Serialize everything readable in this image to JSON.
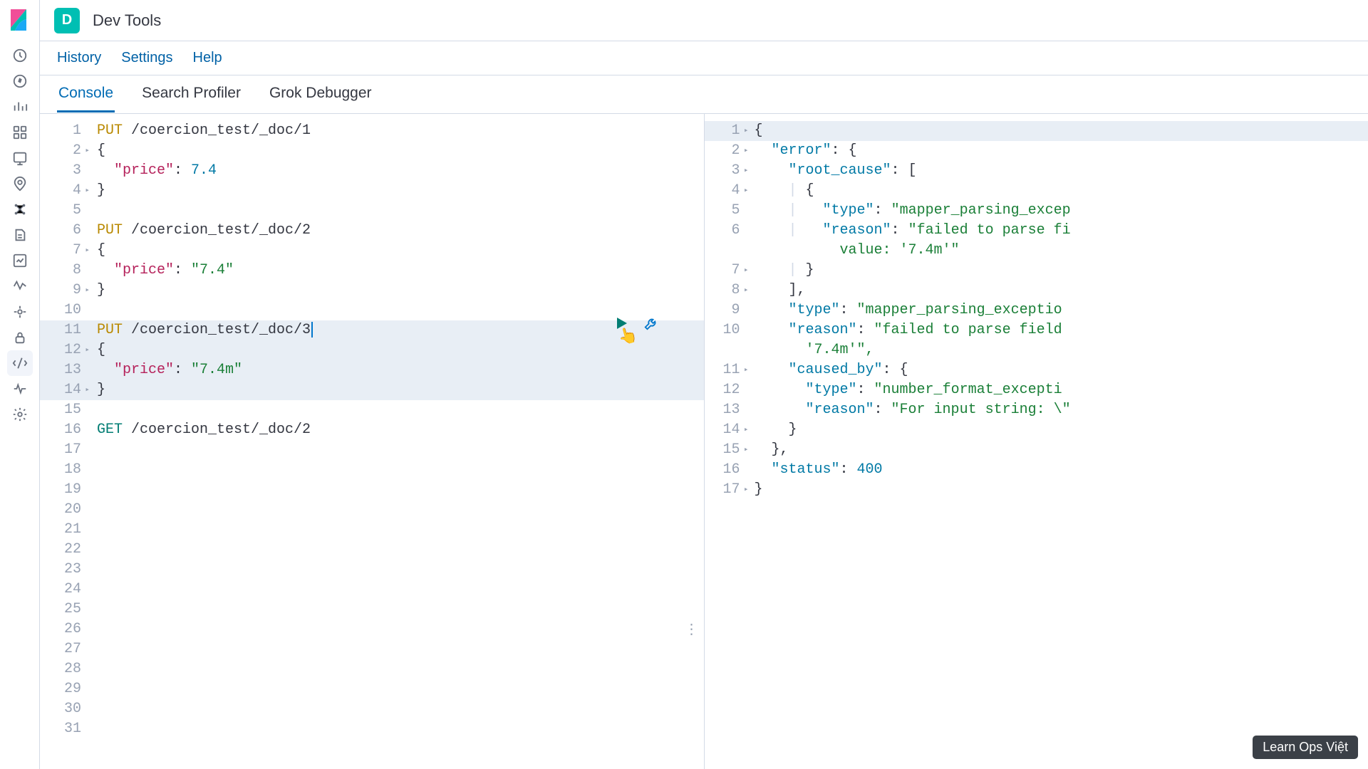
{
  "header": {
    "space_initial": "D",
    "title": "Dev Tools"
  },
  "subheader": {
    "history": "History",
    "settings": "Settings",
    "help": "Help"
  },
  "tabs": {
    "console": "Console",
    "search_profiler": "Search Profiler",
    "grok_debugger": "Grok Debugger"
  },
  "editor": {
    "total_lines": 31,
    "highlight_start": 11,
    "highlight_end": 14,
    "lines": [
      {
        "n": 1,
        "fold": false,
        "segs": [
          {
            "t": "PUT",
            "c": "method-put"
          },
          {
            "t": " /coercion_test/_doc/1",
            "c": ""
          }
        ]
      },
      {
        "n": 2,
        "fold": true,
        "segs": [
          {
            "t": "{",
            "c": "tok-punc"
          }
        ]
      },
      {
        "n": 3,
        "fold": false,
        "segs": [
          {
            "t": "  ",
            "c": ""
          },
          {
            "t": "\"price\"",
            "c": "tok-key"
          },
          {
            "t": ": ",
            "c": "tok-punc"
          },
          {
            "t": "7.4",
            "c": "tok-num"
          }
        ]
      },
      {
        "n": 4,
        "fold": true,
        "segs": [
          {
            "t": "}",
            "c": "tok-punc"
          }
        ]
      },
      {
        "n": 5,
        "fold": false,
        "segs": []
      },
      {
        "n": 6,
        "fold": false,
        "segs": [
          {
            "t": "PUT",
            "c": "method-put"
          },
          {
            "t": " /coercion_test/_doc/2",
            "c": ""
          }
        ]
      },
      {
        "n": 7,
        "fold": true,
        "segs": [
          {
            "t": "{",
            "c": "tok-punc"
          }
        ]
      },
      {
        "n": 8,
        "fold": false,
        "segs": [
          {
            "t": "  ",
            "c": ""
          },
          {
            "t": "\"price\"",
            "c": "tok-key"
          },
          {
            "t": ": ",
            "c": "tok-punc"
          },
          {
            "t": "\"7.4\"",
            "c": "tok-str"
          }
        ]
      },
      {
        "n": 9,
        "fold": true,
        "segs": [
          {
            "t": "}",
            "c": "tok-punc"
          }
        ]
      },
      {
        "n": 10,
        "fold": false,
        "segs": []
      },
      {
        "n": 11,
        "fold": false,
        "cursor": true,
        "segs": [
          {
            "t": "PUT",
            "c": "method-put"
          },
          {
            "t": " /coercion_test/_doc/3",
            "c": ""
          }
        ]
      },
      {
        "n": 12,
        "fold": true,
        "segs": [
          {
            "t": "{",
            "c": "tok-punc"
          }
        ]
      },
      {
        "n": 13,
        "fold": false,
        "segs": [
          {
            "t": "  ",
            "c": ""
          },
          {
            "t": "\"price\"",
            "c": "tok-key"
          },
          {
            "t": ": ",
            "c": "tok-punc"
          },
          {
            "t": "\"7.4m\"",
            "c": "tok-str"
          }
        ]
      },
      {
        "n": 14,
        "fold": true,
        "segs": [
          {
            "t": "}",
            "c": "tok-punc"
          }
        ]
      },
      {
        "n": 15,
        "fold": false,
        "segs": []
      },
      {
        "n": 16,
        "fold": false,
        "segs": [
          {
            "t": "GET",
            "c": "method-get"
          },
          {
            "t": " /coercion_test/_doc/2",
            "c": ""
          }
        ]
      }
    ]
  },
  "output": {
    "lines": [
      {
        "n": 1,
        "fold": true,
        "segs": [
          {
            "t": "{",
            "c": "tok-punc"
          }
        ]
      },
      {
        "n": 2,
        "fold": true,
        "segs": [
          {
            "t": "  ",
            "c": ""
          },
          {
            "t": "\"error\"",
            "c": "tok-err-key"
          },
          {
            "t": ": {",
            "c": "tok-punc"
          }
        ]
      },
      {
        "n": 3,
        "fold": true,
        "segs": [
          {
            "t": "    ",
            "c": ""
          },
          {
            "t": "\"root_cause\"",
            "c": "tok-err-key"
          },
          {
            "t": ": [",
            "c": "tok-punc"
          }
        ]
      },
      {
        "n": 4,
        "fold": true,
        "segs": [
          {
            "t": "    ",
            "c": "indent-guide"
          },
          {
            "t": "| ",
            "c": "indent-guide"
          },
          {
            "t": "{",
            "c": "tok-punc"
          }
        ]
      },
      {
        "n": 5,
        "fold": false,
        "segs": [
          {
            "t": "    ",
            "c": "indent-guide"
          },
          {
            "t": "|   ",
            "c": "indent-guide"
          },
          {
            "t": "\"type\"",
            "c": "tok-err-key"
          },
          {
            "t": ": ",
            "c": "tok-punc"
          },
          {
            "t": "\"mapper_parsing_excep",
            "c": "tok-str"
          }
        ]
      },
      {
        "n": 6,
        "fold": false,
        "segs": [
          {
            "t": "    ",
            "c": "indent-guide"
          },
          {
            "t": "|   ",
            "c": "indent-guide"
          },
          {
            "t": "\"reason\"",
            "c": "tok-err-key"
          },
          {
            "t": ": ",
            "c": "tok-punc"
          },
          {
            "t": "\"failed to parse fi",
            "c": "tok-str"
          }
        ]
      },
      {
        "n": 0,
        "fold": false,
        "segs": [
          {
            "t": "          value: '7.4m'\"",
            "c": "tok-str"
          }
        ]
      },
      {
        "n": 7,
        "fold": true,
        "segs": [
          {
            "t": "    ",
            "c": "indent-guide"
          },
          {
            "t": "| ",
            "c": "indent-guide"
          },
          {
            "t": "}",
            "c": "tok-punc"
          }
        ]
      },
      {
        "n": 8,
        "fold": true,
        "segs": [
          {
            "t": "    ",
            "c": ""
          },
          {
            "t": "],",
            "c": "tok-punc"
          }
        ]
      },
      {
        "n": 9,
        "fold": false,
        "segs": [
          {
            "t": "    ",
            "c": ""
          },
          {
            "t": "\"type\"",
            "c": "tok-err-key"
          },
          {
            "t": ": ",
            "c": "tok-punc"
          },
          {
            "t": "\"mapper_parsing_exceptio",
            "c": "tok-str"
          }
        ]
      },
      {
        "n": 10,
        "fold": false,
        "segs": [
          {
            "t": "    ",
            "c": ""
          },
          {
            "t": "\"reason\"",
            "c": "tok-err-key"
          },
          {
            "t": ": ",
            "c": "tok-punc"
          },
          {
            "t": "\"failed to parse field",
            "c": "tok-str"
          }
        ]
      },
      {
        "n": 0,
        "fold": false,
        "segs": [
          {
            "t": "      '7.4m'\",",
            "c": "tok-str"
          }
        ]
      },
      {
        "n": 11,
        "fold": true,
        "segs": [
          {
            "t": "    ",
            "c": ""
          },
          {
            "t": "\"caused_by\"",
            "c": "tok-err-key"
          },
          {
            "t": ": {",
            "c": "tok-punc"
          }
        ]
      },
      {
        "n": 12,
        "fold": false,
        "segs": [
          {
            "t": "      ",
            "c": ""
          },
          {
            "t": "\"type\"",
            "c": "tok-err-key"
          },
          {
            "t": ": ",
            "c": "tok-punc"
          },
          {
            "t": "\"number_format_excepti",
            "c": "tok-str"
          }
        ]
      },
      {
        "n": 13,
        "fold": false,
        "segs": [
          {
            "t": "      ",
            "c": ""
          },
          {
            "t": "\"reason\"",
            "c": "tok-err-key"
          },
          {
            "t": ": ",
            "c": "tok-punc"
          },
          {
            "t": "\"For input string: \\\"",
            "c": "tok-str"
          }
        ]
      },
      {
        "n": 14,
        "fold": true,
        "segs": [
          {
            "t": "    ",
            "c": ""
          },
          {
            "t": "}",
            "c": "tok-punc"
          }
        ]
      },
      {
        "n": 15,
        "fold": true,
        "segs": [
          {
            "t": "  ",
            "c": ""
          },
          {
            "t": "},",
            "c": "tok-punc"
          }
        ]
      },
      {
        "n": 16,
        "fold": false,
        "segs": [
          {
            "t": "  ",
            "c": ""
          },
          {
            "t": "\"status\"",
            "c": "tok-err-key"
          },
          {
            "t": ": ",
            "c": "tok-punc"
          },
          {
            "t": "400",
            "c": "tok-num"
          }
        ]
      },
      {
        "n": 17,
        "fold": true,
        "segs": [
          {
            "t": "}",
            "c": "tok-punc"
          }
        ]
      }
    ]
  },
  "watermark": "Learn Ops Việt",
  "nav_icons": [
    "recent",
    "discover",
    "visualize",
    "dashboard",
    "canvas",
    "maps",
    "ml",
    "logs",
    "metrics",
    "apm",
    "uptime",
    "security",
    "dev-tools",
    "monitoring",
    "management"
  ]
}
